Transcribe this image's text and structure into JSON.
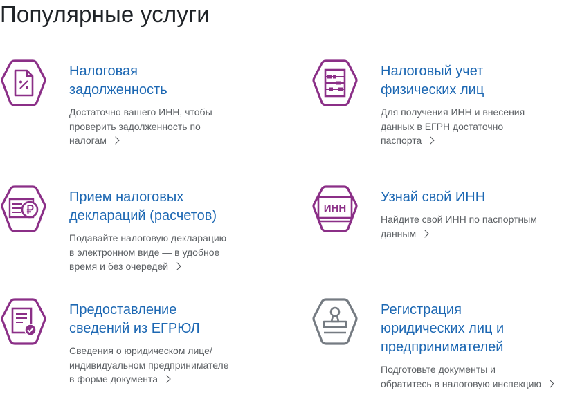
{
  "page": {
    "title": "Популярные услуги"
  },
  "colors": {
    "accent_purple": "#8b2f87",
    "accent_gray": "#757b82",
    "link_blue": "#1d68b3",
    "text_gray": "#5b5f63"
  },
  "services": [
    {
      "title_line1": "Налоговая",
      "title_line2": "задолженность",
      "title_line3": "",
      "desc_line1": "Достаточно вашего ИНН, чтобы",
      "desc_line2": "проверить задолженность по",
      "desc_line3": "налогам",
      "icon": "tax-debt-document-percent-icon",
      "icon_color": "purple"
    },
    {
      "title_line1": "Налоговый учет",
      "title_line2": "физических лиц",
      "title_line3": "",
      "desc_line1": "Для получения ИНН и внесения",
      "desc_line2": "данных в ЕГРН достаточно",
      "desc_line3": "паспорта",
      "icon": "abacus-icon",
      "icon_color": "purple"
    },
    {
      "title_line1": "Прием налоговых",
      "title_line2": "деклараций (расчетов)",
      "title_line3": "",
      "desc_line1": "Подавайте налоговую декларацию",
      "desc_line2": "в электронном виде — в удобное",
      "desc_line3": "время и без очередей",
      "icon": "document-ruble-icon",
      "icon_color": "purple"
    },
    {
      "title_line1": "Узнай свой ИНН",
      "title_line2": "",
      "title_line3": "",
      "desc_line1": "Найдите свой ИНН по паспортным",
      "desc_line2": "данным",
      "desc_line3": "",
      "icon": "inn-card-icon",
      "icon_color": "purple",
      "icon_text": "ИНН"
    },
    {
      "title_line1": "Предоставление",
      "title_line2": "сведений из ЕГРЮЛ",
      "title_line3": "",
      "desc_line1": "Сведения о юридическом лице/",
      "desc_line2": "индивидуальном предпринимателе",
      "desc_line3": "в форме документа",
      "icon": "document-check-icon",
      "icon_color": "purple"
    },
    {
      "title_line1": "Регистрация",
      "title_line2": "юридических лиц и",
      "title_line3": "предпринимателей",
      "desc_line1": "Подготовьте документы и",
      "desc_line2": "обратитесь в налоговую инспекцию",
      "desc_line3": "",
      "icon": "stamp-icon",
      "icon_color": "gray"
    }
  ]
}
